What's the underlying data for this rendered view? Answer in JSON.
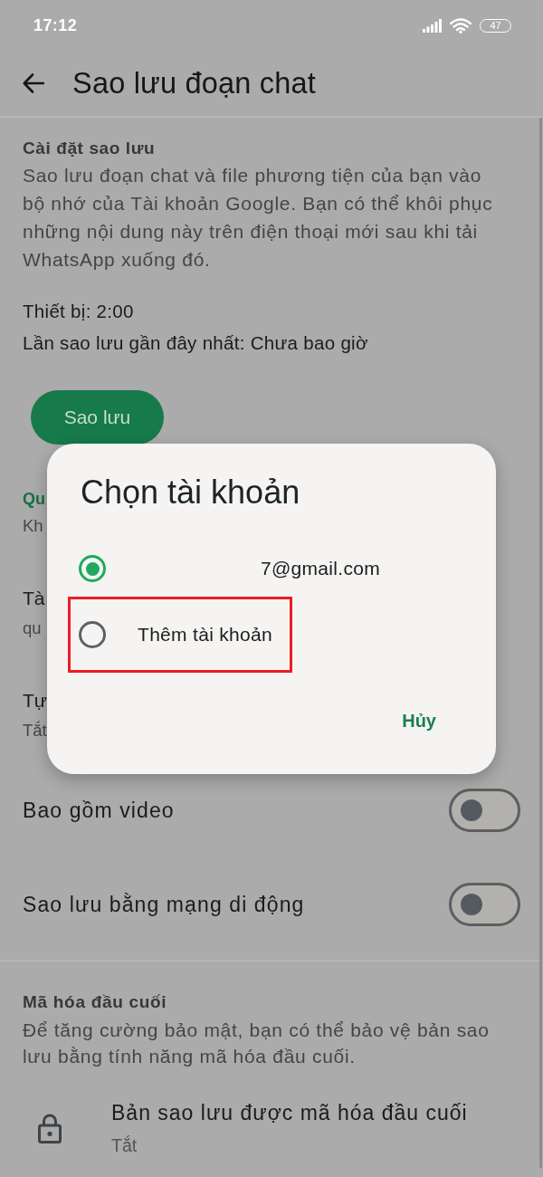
{
  "status_bar": {
    "time": "17:12",
    "battery": "47"
  },
  "app_bar": {
    "title": "Sao lưu đoạn chat"
  },
  "backup_settings": {
    "heading": "Cài đặt sao lưu",
    "description": "Sao lưu đoạn chat và file phương tiện của bạn vào bộ nhớ của Tài khoản Google. Bạn có thể khôi phục những nội dung này trên điện thoại mới sau khi tải WhatsApp xuống đó.",
    "device": "Thiết bị: 2:00",
    "last_backup": "Lần sao lưu gần đây nhất: Chưa bao giờ",
    "backup_button": "Sao lưu"
  },
  "covered_rows": [
    {
      "kind": "section",
      "title": "Qu",
      "subtitle": "Kh"
    },
    {
      "kind": "setting",
      "title": "Tà",
      "subtitle": "qu"
    },
    {
      "kind": "setting",
      "title": "Tự",
      "subtitle": "Tắt"
    }
  ],
  "toggles": [
    {
      "label": "Bao gồm video",
      "on": false
    },
    {
      "label": "Sao lưu bằng mạng di động",
      "on": false
    }
  ],
  "encryption": {
    "heading": "Mã hóa đầu cuối",
    "description": "Để tăng cường bảo mật, bạn có thể bảo vệ bản sao lưu bằng tính năng mã hóa đầu cuối.",
    "item": {
      "title": "Bản sao lưu được mã hóa đầu cuối",
      "value": "Tắt"
    }
  },
  "dialog": {
    "title": "Chọn tài khoản",
    "options": [
      {
        "label": "7@gmail.com",
        "selected": true,
        "highlighted": false
      },
      {
        "label": "Thêm tài khoản",
        "selected": false,
        "highlighted": true
      }
    ],
    "cancel_button": "Hủy"
  }
}
